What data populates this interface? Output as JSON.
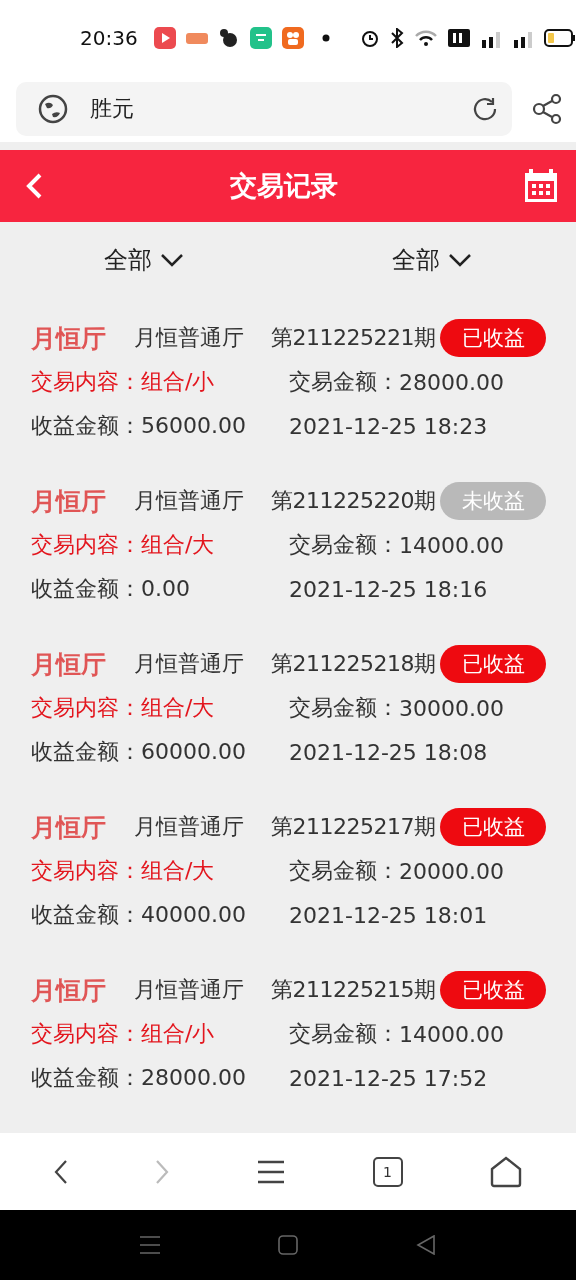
{
  "status_bar": {
    "time": "20:36"
  },
  "address_bar": {
    "text": "胜元"
  },
  "header": {
    "title": "交易记录"
  },
  "filters": [
    {
      "label": "全部"
    },
    {
      "label": "全部"
    }
  ],
  "records": [
    {
      "room": "月恒厅",
      "hall": "月恒普通厅",
      "period": "第211225221期",
      "status": "已收益",
      "settled": true,
      "content_label": "交易内容：",
      "content": "组合/小",
      "amount_label": "交易金额：",
      "amount": "28000.00",
      "income_label": "收益金额：",
      "income": "56000.00",
      "time": "2021-12-25 18:23"
    },
    {
      "room": "月恒厅",
      "hall": "月恒普通厅",
      "period": "第211225220期",
      "status": "未收益",
      "settled": false,
      "content_label": "交易内容：",
      "content": "组合/大",
      "amount_label": "交易金额：",
      "amount": "14000.00",
      "income_label": "收益金额：",
      "income": "0.00",
      "time": "2021-12-25 18:16"
    },
    {
      "room": "月恒厅",
      "hall": "月恒普通厅",
      "period": "第211225218期",
      "status": "已收益",
      "settled": true,
      "content_label": "交易内容：",
      "content": "组合/大",
      "amount_label": "交易金额：",
      "amount": "30000.00",
      "income_label": "收益金额：",
      "income": "60000.00",
      "time": "2021-12-25 18:08"
    },
    {
      "room": "月恒厅",
      "hall": "月恒普通厅",
      "period": "第211225217期",
      "status": "已收益",
      "settled": true,
      "content_label": "交易内容：",
      "content": "组合/大",
      "amount_label": "交易金额：",
      "amount": "20000.00",
      "income_label": "收益金额：",
      "income": "40000.00",
      "time": "2021-12-25 18:01"
    },
    {
      "room": "月恒厅",
      "hall": "月恒普通厅",
      "period": "第211225215期",
      "status": "已收益",
      "settled": true,
      "content_label": "交易内容：",
      "content": "组合/小",
      "amount_label": "交易金额：",
      "amount": "14000.00",
      "income_label": "收益金额：",
      "income": "28000.00",
      "time": "2021-12-25 17:52"
    }
  ],
  "bottom_nav": {
    "tab_count": "1"
  }
}
